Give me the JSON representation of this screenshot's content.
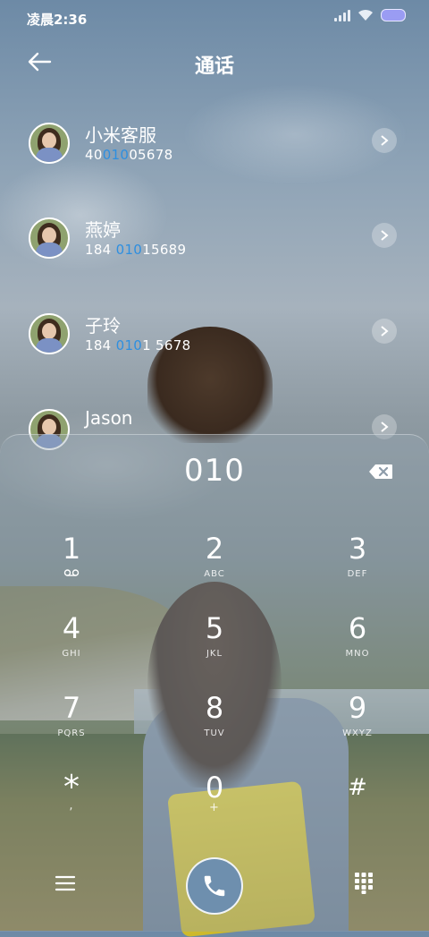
{
  "status": {
    "time": "凌晨2:36"
  },
  "header": {
    "title": "通话"
  },
  "contacts": [
    {
      "name": "小米客服",
      "num_pre": "40",
      "num_hl": "010",
      "num_post": "05678"
    },
    {
      "name": "燕婷",
      "num_pre": "184 ",
      "num_hl": "010",
      "num_post": "15689"
    },
    {
      "name": "子玲",
      "num_pre": "184 ",
      "num_hl": "010",
      "num_post": "1 5678"
    },
    {
      "name": "Jason",
      "num_pre": "",
      "num_hl": "",
      "num_post": ""
    }
  ],
  "dialer": {
    "display": "010",
    "keys": [
      {
        "digit": "1",
        "letters": ""
      },
      {
        "digit": "2",
        "letters": "ABC"
      },
      {
        "digit": "3",
        "letters": "DEF"
      },
      {
        "digit": "4",
        "letters": "GHI"
      },
      {
        "digit": "5",
        "letters": "JKL"
      },
      {
        "digit": "6",
        "letters": "MNO"
      },
      {
        "digit": "7",
        "letters": "PQRS"
      },
      {
        "digit": "8",
        "letters": "TUV"
      },
      {
        "digit": "9",
        "letters": "WXYZ"
      },
      {
        "digit": "*",
        "letters": ","
      },
      {
        "digit": "0",
        "letters": "+"
      },
      {
        "digit": "#",
        "letters": ""
      }
    ]
  },
  "icons": {
    "back": "arrow-left-icon",
    "chevron": "chevron-right-icon",
    "backspace": "backspace-icon",
    "voicemail": "voicemail-icon",
    "menu": "menu-icon",
    "call": "phone-icon",
    "dialpad": "dialpad-icon"
  },
  "colors": {
    "highlight": "#2e8fe0",
    "call_button": "#6e8fae",
    "battery": "#9a9cf3"
  }
}
